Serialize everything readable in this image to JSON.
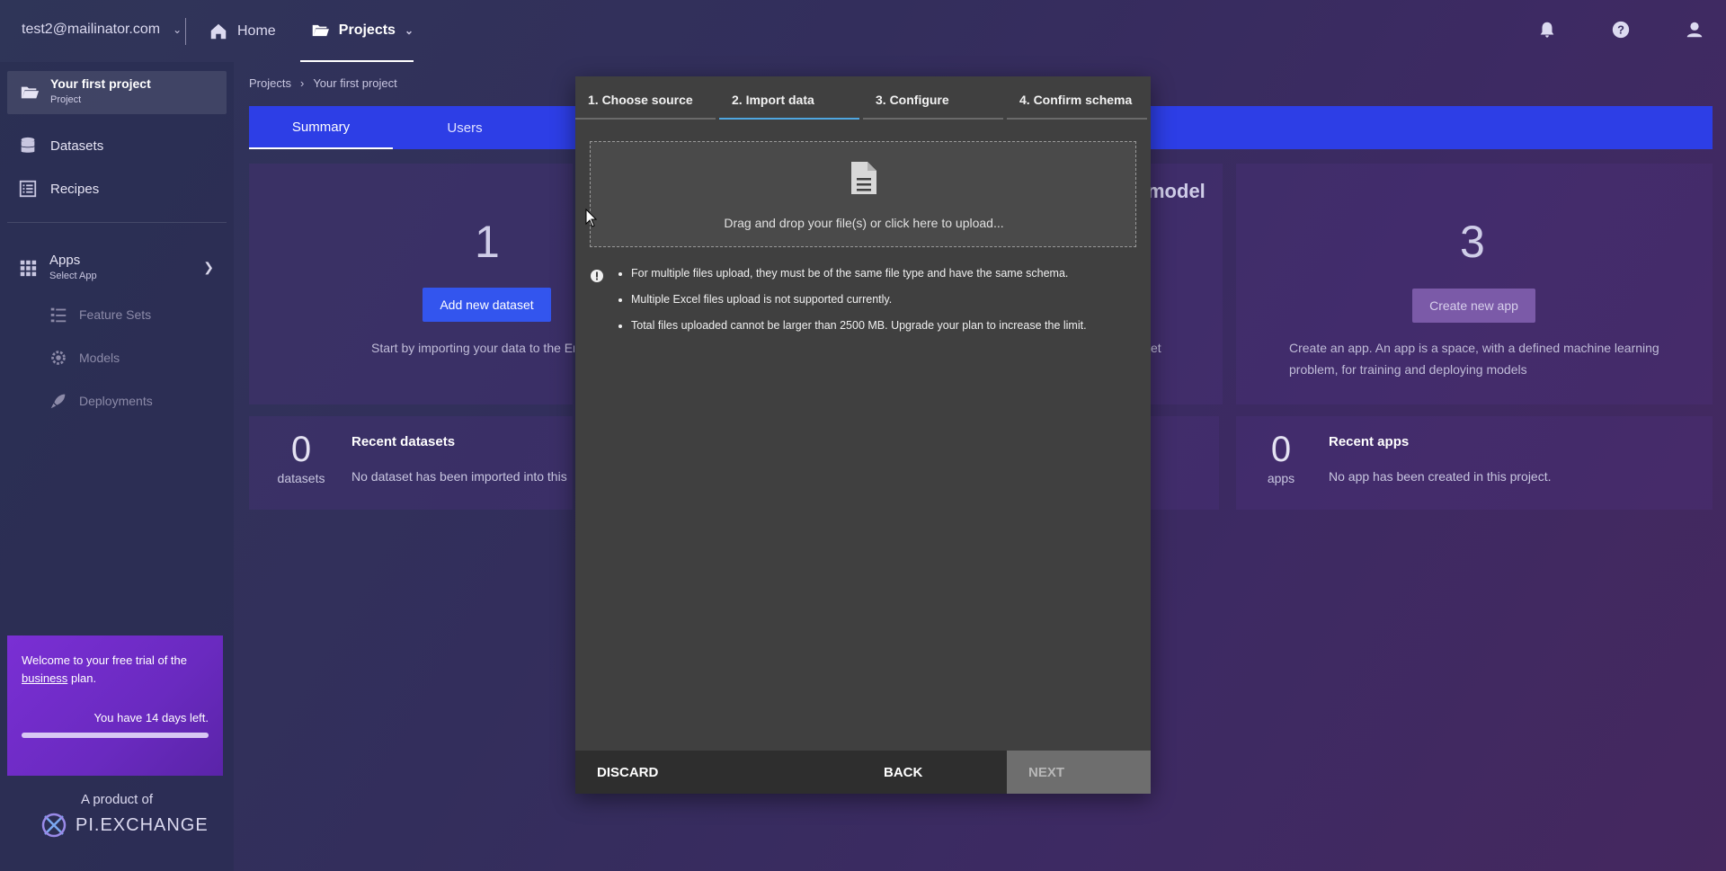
{
  "topbar": {
    "account": "test2@mailinator.com",
    "home": "Home",
    "projects": "Projects"
  },
  "sidebar": {
    "project_title": "Your first project",
    "project_sub": "Project",
    "datasets": "Datasets",
    "recipes": "Recipes",
    "apps_title": "Apps",
    "apps_sub": "Select App",
    "feature_sets": "Feature Sets",
    "models": "Models",
    "deployments": "Deployments",
    "trial_prefix": "Welcome to your free trial of the",
    "trial_link": "business",
    "trial_suffix": "plan.",
    "trial_days": "You have 14 days left.",
    "trial_progress": 1.0,
    "product_of": "A product of",
    "logo_text": "PI.EXCHANGE"
  },
  "main": {
    "breadcrumb_root": "Projects",
    "breadcrumb_current": "Your first project",
    "tabs": [
      "Summary",
      "Users"
    ],
    "datasets_count": "1",
    "add_dataset": "Add new dataset",
    "datasets_text": "Start by importing your data to the Er",
    "model_title_fragment": "model",
    "model_text_fragment": "et",
    "apps_count": "3",
    "create_app": "Create new app",
    "apps_text": "Create an app. An app is a space, with a defined machine learning problem, for training and deploying models",
    "recent_datasets_num": "0",
    "recent_datasets_lbl": "datasets",
    "recent_datasets_title": "Recent datasets",
    "recent_datasets_text": "No dataset has been imported into this",
    "recent_apps_num": "0",
    "recent_apps_lbl": "apps",
    "recent_apps_title": "Recent apps",
    "recent_apps_text": "No app has been created in this project."
  },
  "modal": {
    "steps": [
      "1. Choose source",
      "2. Import data",
      "3. Configure",
      "4. Confirm schema"
    ],
    "active_step": 1,
    "drop_text": "Drag and drop your file(s) or click here to upload...",
    "notes": [
      "For multiple files upload, they must be of the same file type and have the same schema.",
      "Multiple Excel files upload is not supported currently.",
      "Total files uploaded cannot be larger than 2500 MB. Upgrade your plan to increase the limit."
    ],
    "discard": "DISCARD",
    "back": "BACK",
    "next": "NEXT"
  },
  "colors": {
    "accent_blue": "#2d3ee6",
    "primary_button": "#3355ee",
    "trial_purple": "#7a2fd4",
    "active_step_underline": "#4fa6e0"
  },
  "icons": [
    "home-icon",
    "folder-icon",
    "bell-icon",
    "help-icon",
    "user-icon",
    "database-icon",
    "list-icon",
    "grid-icon",
    "document-icon",
    "info-icon"
  ]
}
